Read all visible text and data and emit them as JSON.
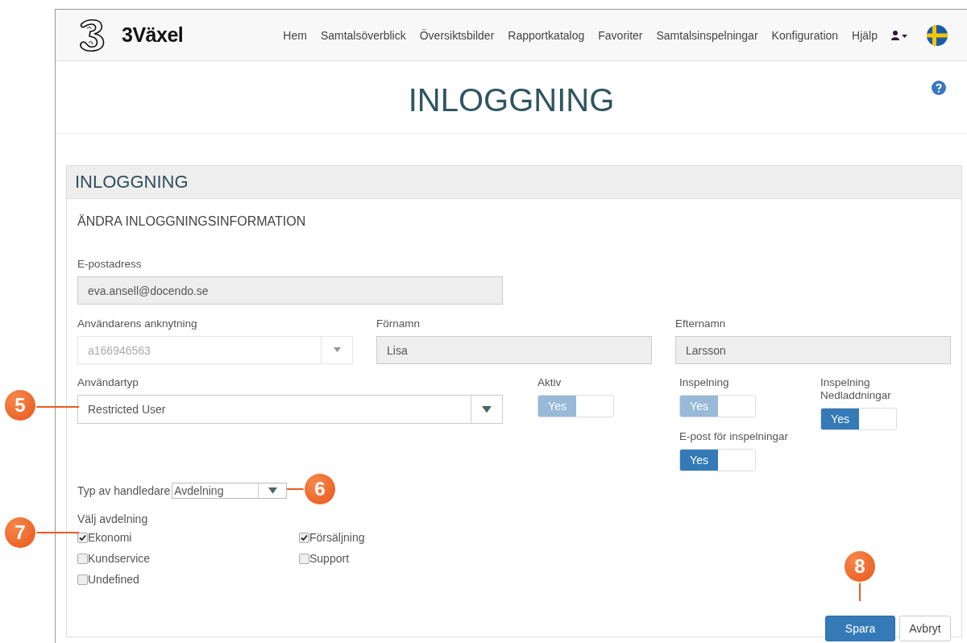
{
  "header": {
    "logo_text": "3Växel",
    "nav": [
      "Hem",
      "Samtalsöverblick",
      "Översiktsbilder",
      "Rapportkatalog",
      "Favoriter",
      "Samtalsinspelningar",
      "Konfiguration",
      "Hjälp"
    ]
  },
  "page_title": "INLOGGNING",
  "panel": {
    "title": "INLOGGNING",
    "subtitle": "ÄNDRA INLOGGNINGSINFORMATION",
    "email": {
      "label": "E-postadress",
      "value": "eva.ansell@docendo.se"
    },
    "extension": {
      "label": "Användarens anknytning",
      "value": "a166946563",
      "disabled": true
    },
    "first_name": {
      "label": "Förnamn",
      "value": "Lisa"
    },
    "last_name": {
      "label": "Efternamn",
      "value": "Larsson"
    },
    "user_type": {
      "label": "Användartyp",
      "value": "Restricted User"
    },
    "toggles": [
      {
        "label": "Aktiv",
        "value": "Yes",
        "on": true,
        "disabled": true
      },
      {
        "label": "Inspelning",
        "value": "Yes",
        "on": true,
        "disabled": true
      },
      {
        "label": "Inspelning Nedladdningar",
        "value": "Yes",
        "on": true,
        "disabled": false
      },
      {
        "label": "E-post för inspelningar",
        "value": "Yes",
        "on": true,
        "disabled": false
      }
    ],
    "supervisor_type": {
      "label": "Typ av handledare",
      "value": "Avdelning"
    },
    "departments": {
      "label": "Välj avdelning",
      "items": [
        {
          "label": "Ekonomi",
          "checked": true
        },
        {
          "label": "Försäljning",
          "checked": true
        },
        {
          "label": "Kundservice",
          "checked": false
        },
        {
          "label": "Support",
          "checked": false
        },
        {
          "label": "Undefined",
          "checked": false
        }
      ]
    },
    "buttons": [
      {
        "label": "Spara",
        "kind": "primary"
      },
      {
        "label": "Avbryt",
        "kind": "default"
      }
    ]
  },
  "callouts": [
    "5",
    "6",
    "7",
    "8"
  ]
}
